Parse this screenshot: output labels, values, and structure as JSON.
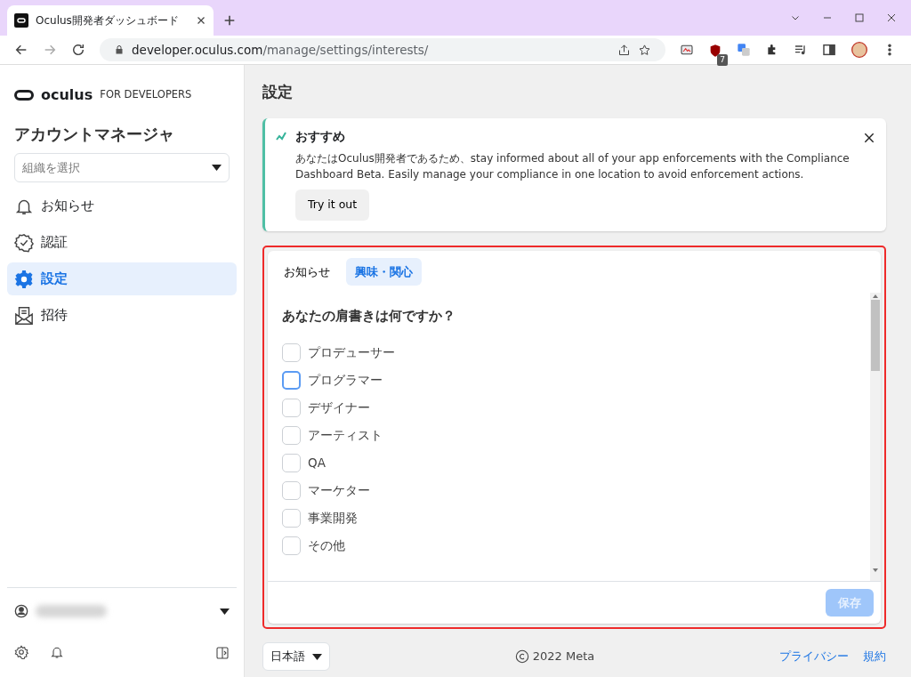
{
  "browser": {
    "tab_title": "Oculus開発者ダッシュボード",
    "url_host": "developer.oculus.com",
    "url_path": "/manage/settings/interests/",
    "extension_badge": "7"
  },
  "sidebar": {
    "brand": "oculus",
    "brand_suffix": "FOR DEVELOPERS",
    "title": "アカウントマネージャ",
    "org_select": {
      "placeholder": "組織を選択"
    },
    "items": [
      {
        "label": "お知らせ",
        "kind": "bell",
        "selected": false
      },
      {
        "label": "認証",
        "kind": "badge",
        "selected": false
      },
      {
        "label": "設定",
        "kind": "gear",
        "selected": true
      },
      {
        "label": "招待",
        "kind": "envelope",
        "selected": false
      }
    ]
  },
  "main": {
    "heading": "設定",
    "banner": {
      "title": "おすすめ",
      "text": "あなたはOculus開発者であるため、stay informed about all of your app enforcements with the Compliance Dashboard Beta. Easily manage your compliance in one location to avoid enforcement actions.",
      "button": "Try it out"
    },
    "tabs": [
      {
        "label": "お知らせ",
        "selected": false
      },
      {
        "label": "興味・関心",
        "selected": true
      }
    ],
    "question": "あなたの肩書きは何ですか？",
    "options": [
      {
        "label": "プロデューサー",
        "checked": false,
        "focused": false
      },
      {
        "label": "プログラマー",
        "checked": false,
        "focused": true
      },
      {
        "label": "デザイナー",
        "checked": false,
        "focused": false
      },
      {
        "label": "アーティスト",
        "checked": false,
        "focused": false
      },
      {
        "label": "QA",
        "checked": false,
        "focused": false
      },
      {
        "label": "マーケター",
        "checked": false,
        "focused": false
      },
      {
        "label": "事業開発",
        "checked": false,
        "focused": false
      },
      {
        "label": "その他",
        "checked": false,
        "focused": false
      }
    ],
    "save_button": {
      "label": "保存",
      "disabled": true
    }
  },
  "footer": {
    "language": "日本語",
    "copyright": "2022 Meta",
    "links": [
      "プライバシー",
      "規約"
    ]
  }
}
